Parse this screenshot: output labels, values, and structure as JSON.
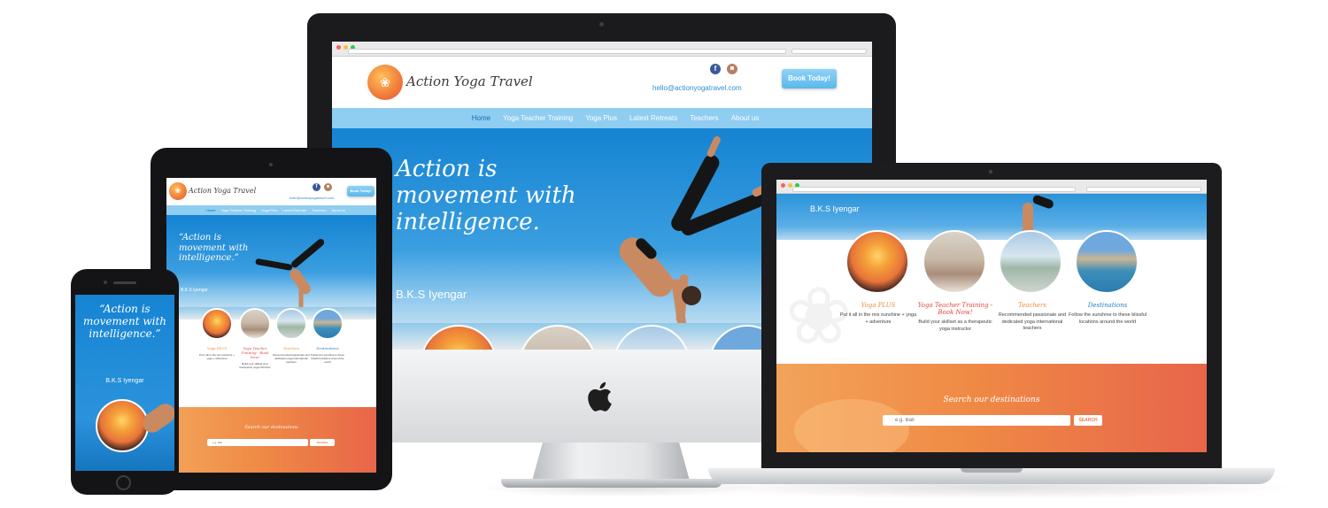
{
  "site": {
    "brand": "Action Yoga Travel",
    "email": "hello@actionyogatravel.com",
    "book_button": "Book Today!",
    "social": {
      "facebook": "f",
      "instagram": "◙"
    },
    "nav": [
      "Home",
      "Yoga Teacher Training",
      "Yoga Plus",
      "Latest Retreats",
      "Teachers",
      "About us"
    ],
    "hero": {
      "quote_open": "“",
      "quote_line1": "Action is",
      "quote_line2": "movement with",
      "quote_line3": "intelligence.",
      "quote_close": "”",
      "author": "B.K.S Iyengar"
    },
    "features": [
      {
        "title": "Yoga PLUS",
        "desc": "Put it all in the mix sunshine + yoga + adventure"
      },
      {
        "title": "Yoga Teacher Training - Book Now!",
        "desc": "Build your skillset as a therapeutic yoga instructor"
      },
      {
        "title": "Teachers",
        "desc": "Recommended passionate and dedicated yoga international teachers"
      },
      {
        "title": "Destinations",
        "desc": "Follow the sunshine to these blissful locations around the world"
      }
    ],
    "search": {
      "title": "Search our destinations",
      "placeholder": "e.g. Bali",
      "button": "SEARCH"
    }
  },
  "colors": {
    "nav_bar": "#8fcdf1",
    "nav_active": "#1a6fb0",
    "hero_blue": "#1583d2",
    "accent_orange": "#ef7a49",
    "feature_title_orange": "#f08a3c",
    "feature_title_red": "#e0443d",
    "feature_title_blue": "#2b7bc0",
    "email_blue": "#2d8fd0"
  },
  "icons": {
    "lotus": "lotus-logo-icon",
    "facebook": "facebook-icon",
    "instagram": "instagram-icon",
    "apple": "apple-logo-icon"
  }
}
